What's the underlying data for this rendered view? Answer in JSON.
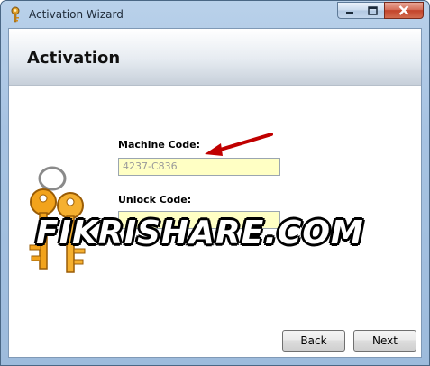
{
  "window": {
    "title": "Activation Wizard",
    "caption_buttons": [
      "minimize",
      "maximize",
      "close"
    ]
  },
  "header": {
    "title": "Activation"
  },
  "form": {
    "machine_code_label": "Machine Code:",
    "machine_code_value": "4237-C836",
    "unlock_code_label": "Unlock Code:",
    "unlock_code_value": ""
  },
  "watermark": {
    "text": "FIKRISHARE.COM"
  },
  "buttons": {
    "back_label": "Back",
    "next_label": "Next"
  },
  "colors": {
    "input_background": "#ffffc4",
    "arrow": "#c00000",
    "keys": "#f2a31c"
  },
  "icons": {
    "title_icon": "key-icon",
    "decoration": "keys-icon",
    "annotation": "arrow-icon"
  }
}
